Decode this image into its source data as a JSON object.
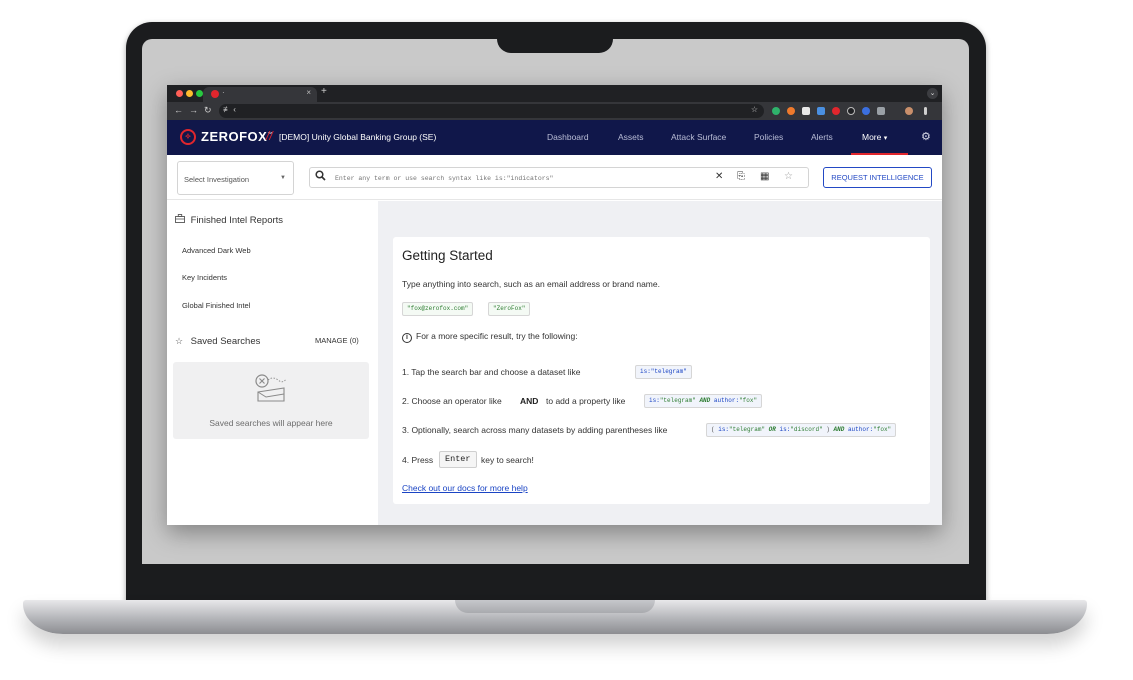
{
  "browser": {
    "tab_title": "·",
    "tab_close": "×",
    "new_tab": "+",
    "menu_icon": "⌄",
    "nav": {
      "back": "←",
      "forward": "→",
      "reload": "↻"
    },
    "url_text": "≢ ‹",
    "bookmark_icon": "☆",
    "colors": {
      "close": "#ff5f57",
      "minimize": "#febc2e",
      "maximize": "#28c840"
    }
  },
  "app": {
    "logo_text": "ZEROFOX",
    "logo_trademark": "™",
    "separator": "//",
    "org_name": "[DEMO] Unity Global Banking Group (SE)",
    "nav": [
      "Dashboard",
      "Assets",
      "Attack Surface",
      "Policies",
      "Alerts"
    ],
    "more_label": "More",
    "more_caret": "▾",
    "settings_icon": "⚙",
    "brand_color": "#e0262d",
    "header_color": "#10174a"
  },
  "search": {
    "investigation_select": "Select Investigation",
    "select_caret": "▼",
    "placeholder": "Enter any term or use search syntax like is:\"indicators\"",
    "clear_icon": "✕",
    "copy_icon": "⎘",
    "calendar_icon": "▦",
    "star_icon": "☆",
    "request_button": "REQUEST INTELLIGENCE"
  },
  "sidebar": {
    "finished_title": "Finished Intel Reports",
    "finished_items": [
      "Advanced Dark Web",
      "Key Incidents",
      "Global Finished Intel"
    ],
    "saved_title": "Saved Searches",
    "manage_label": "MANAGE (0)",
    "saved_empty": "Saved searches will appear here"
  },
  "main": {
    "title": "Getting Started",
    "subtitle": "Type anything into search, such as an email address or brand name.",
    "example_1": "\"fox@zerofox.com\"",
    "example_2": "\"ZeroFox\"",
    "info_text": "For a more specific result, try the following:",
    "step1": "1. Tap the search bar and choose a dataset like",
    "step1_code": "is:\"telegram\"",
    "step2_a": "2. Choose an operator like",
    "step2_kw": "AND",
    "step2_b": "to add a property like",
    "step2_code_key": "is:",
    "step2_code_val": "\"telegram\"",
    "step2_code_op": "AND",
    "step2_code_key2": "author:",
    "step2_code_val2": "\"fox\"",
    "step3": "3. Optionally, search across many datasets by adding parentheses like",
    "step3_code": {
      "open": "(",
      "k1": "is:",
      "v1": "\"telegram\"",
      "or": "OR",
      "k2": "is:",
      "v2": "\"discord\"",
      "close": ")",
      "and": "AND",
      "k3": "author:",
      "v3": "\"fox\""
    },
    "step4_a": "4. Press",
    "step4_key": "Enter",
    "step4_b": "key to search!",
    "docs_link": "Check out our docs for more help"
  }
}
